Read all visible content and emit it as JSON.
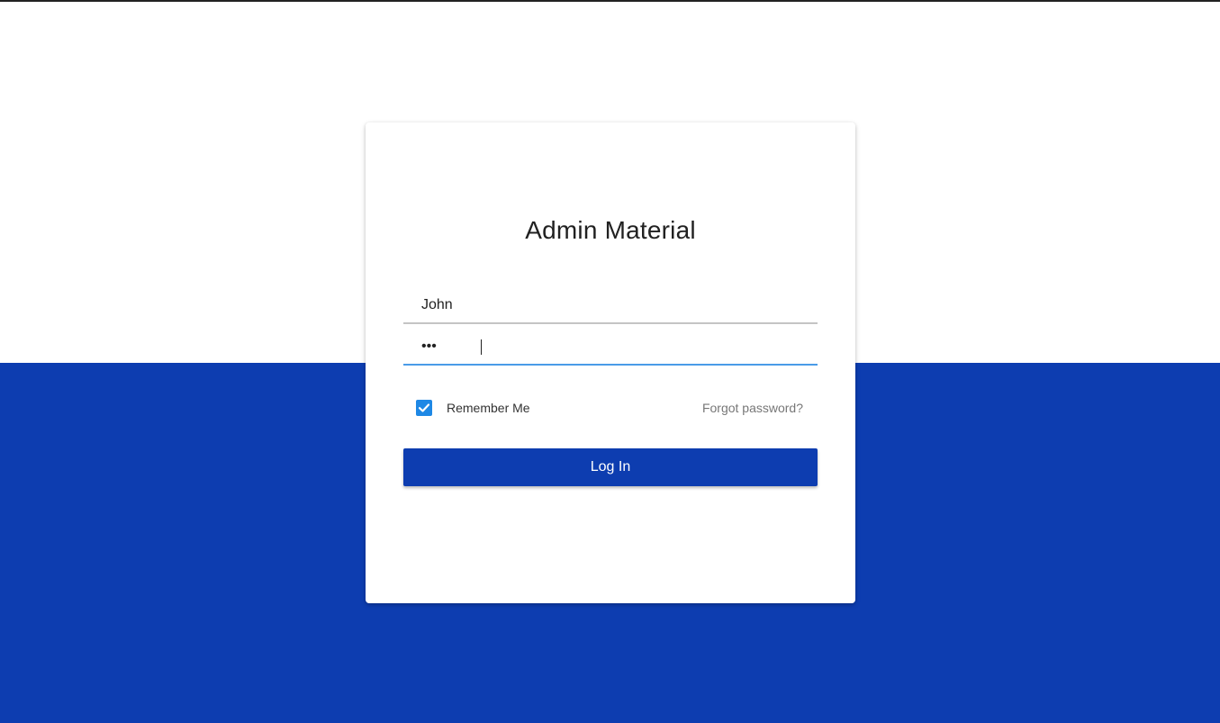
{
  "app": {
    "title": "Admin Material"
  },
  "form": {
    "username": {
      "value": "John"
    },
    "password": {
      "value": "abc"
    },
    "remember_me": {
      "label": "Remember Me",
      "checked": true
    },
    "forgot_password_label": "Forgot password?",
    "login_label": "Log In"
  },
  "icons": {
    "checkbox": "check-icon"
  },
  "colors": {
    "brand_blue": "#0d3db0",
    "checkbox_blue": "#1e88e5",
    "focus_underline": "#4a9be8"
  }
}
